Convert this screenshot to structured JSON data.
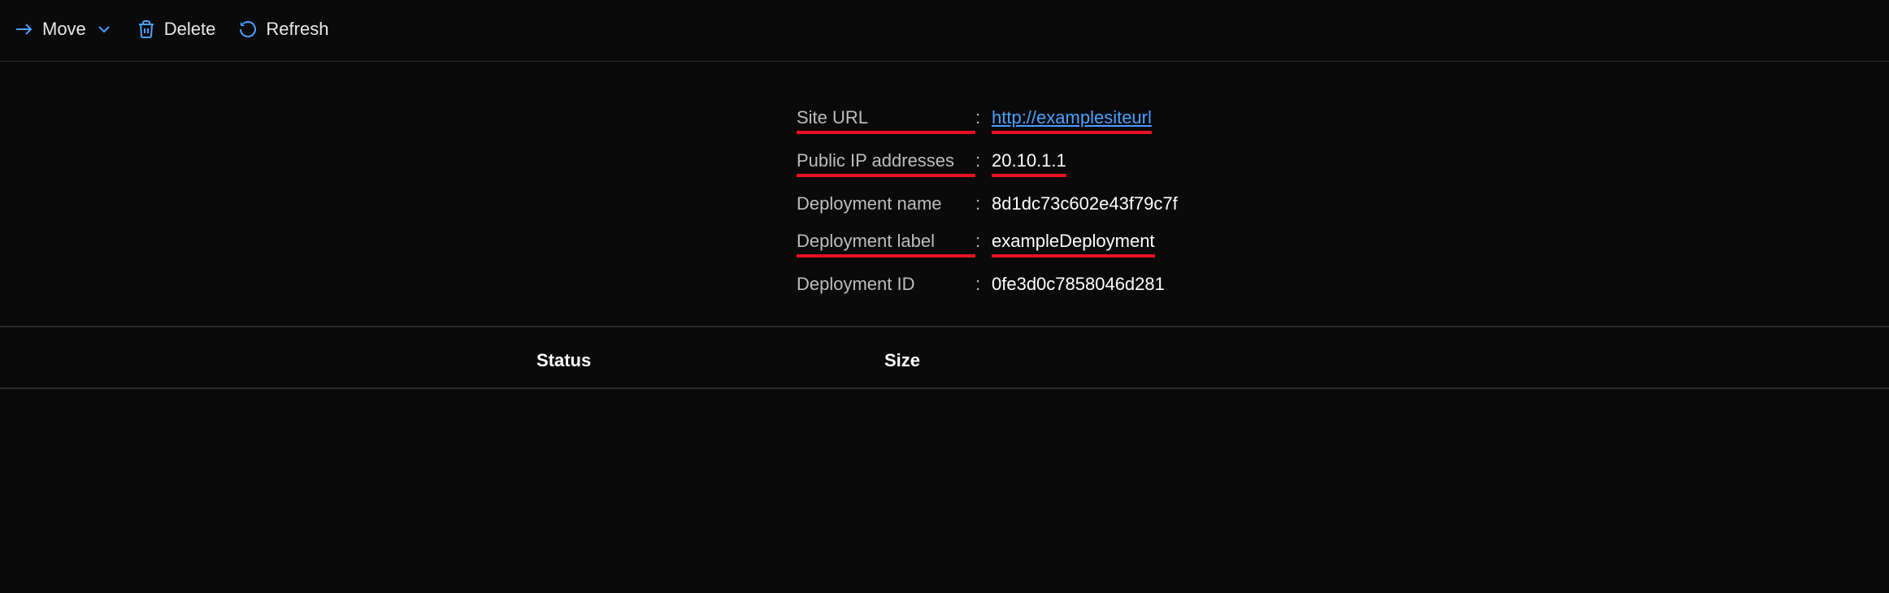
{
  "toolbar": {
    "move_label": "Move",
    "delete_label": "Delete",
    "refresh_label": "Refresh"
  },
  "details": {
    "site_url": {
      "label": "Site URL",
      "value": "http://examplesiteurl"
    },
    "public_ip": {
      "label": "Public IP addresses",
      "value": "20.10.1.1"
    },
    "deployment_name": {
      "label": "Deployment name",
      "value": "8d1dc73c602e43f79c7f"
    },
    "deployment_label": {
      "label": "Deployment label",
      "value": "exampleDeployment"
    },
    "deployment_id": {
      "label": "Deployment ID",
      "value": "0fe3d0c7858046d281"
    }
  },
  "table": {
    "status_header": "Status",
    "size_header": "Size"
  }
}
